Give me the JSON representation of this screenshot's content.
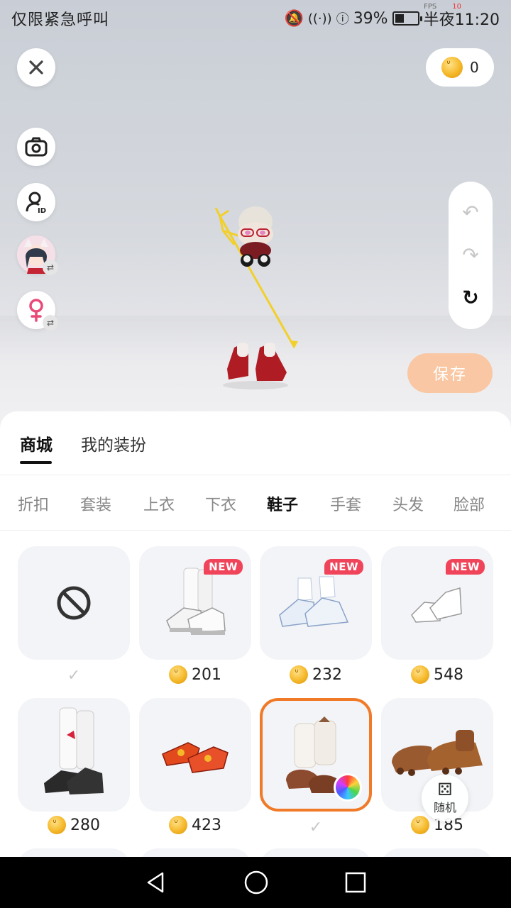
{
  "status_bar": {
    "carrier": "仅限紧急呼叫",
    "battery": "39%",
    "time": "半夜11:20",
    "fps_label": "FPS",
    "fps_value": "10"
  },
  "coin_balance": "0",
  "save_label": "保存",
  "random_label": "随机",
  "sheet_tabs": [
    {
      "label": "商城",
      "active": true
    },
    {
      "label": "我的装扮",
      "active": false
    }
  ],
  "categories": [
    {
      "label": "折扣"
    },
    {
      "label": "套装"
    },
    {
      "label": "上衣"
    },
    {
      "label": "下衣"
    },
    {
      "label": "鞋子",
      "active": true
    },
    {
      "label": "手套"
    },
    {
      "label": "头发"
    },
    {
      "label": "脸部"
    }
  ],
  "items": [
    {
      "kind": "none-icon",
      "check": "✓"
    },
    {
      "kind": "white-sneakers",
      "badge": "NEW",
      "price": "201"
    },
    {
      "kind": "white-ruffle-shoes",
      "badge": "NEW",
      "price": "232"
    },
    {
      "kind": "glass-heels",
      "badge": "NEW",
      "price": "548"
    },
    {
      "kind": "leg-warmer-boots",
      "price": "280"
    },
    {
      "kind": "red-flats",
      "price": "423"
    },
    {
      "kind": "brown-fluffy-boots",
      "selected": true,
      "check": "✓"
    },
    {
      "kind": "paw-slippers",
      "price": "185"
    }
  ],
  "colors": {
    "accent": "#f07a28",
    "save_button": "#f9c7a3",
    "new_badge": "#f0445a"
  }
}
